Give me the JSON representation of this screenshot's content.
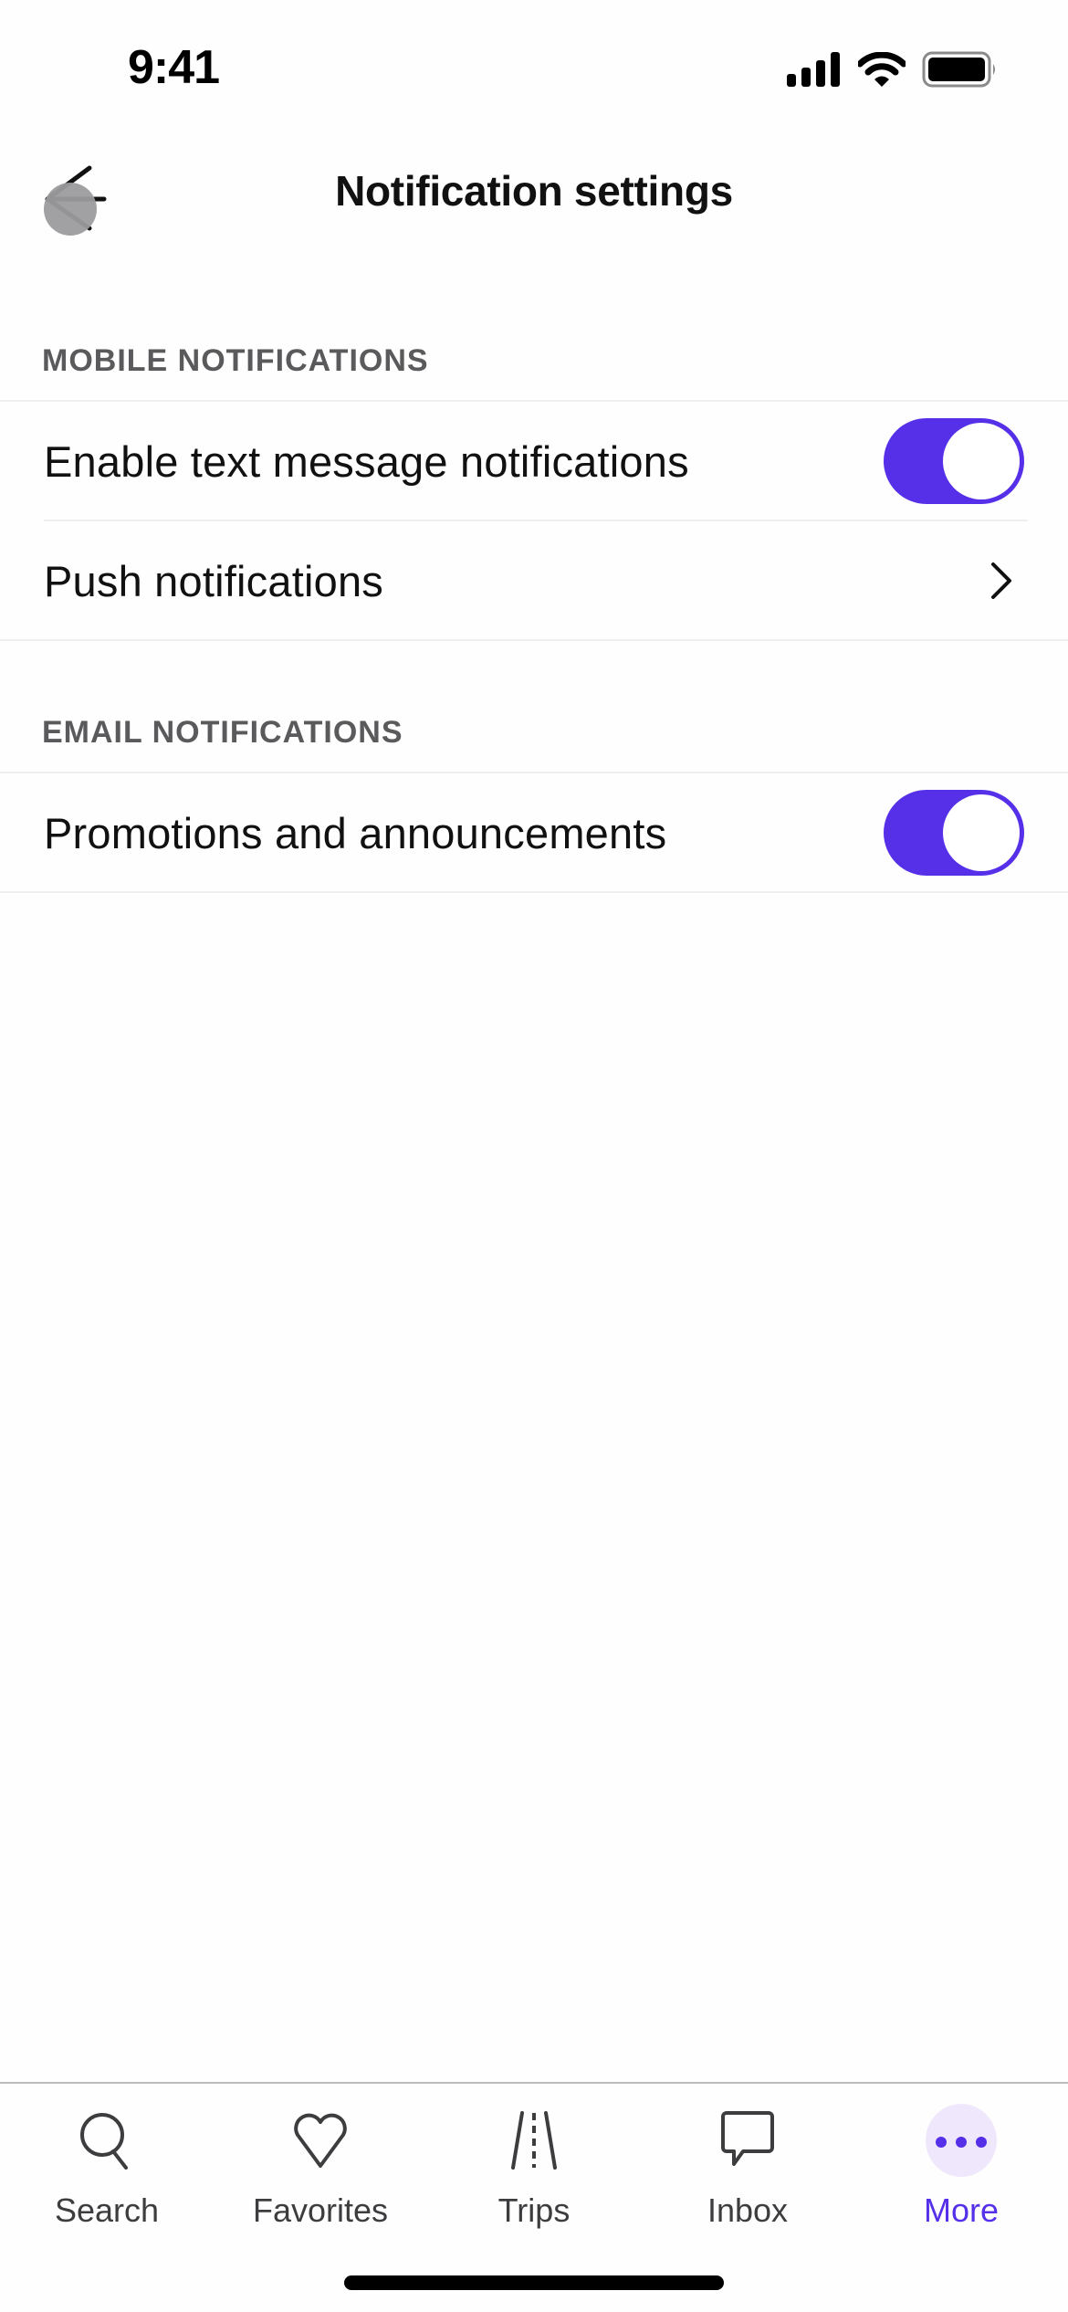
{
  "status_bar": {
    "time": "9:41",
    "icons": [
      "cellular-signal-icon",
      "wifi-icon",
      "battery-icon"
    ]
  },
  "header": {
    "title": "Notification settings",
    "back_icon": "arrow-left-icon"
  },
  "sections": [
    {
      "title": "MOBILE NOTIFICATIONS",
      "rows": [
        {
          "label": "Enable text message notifications",
          "control": "toggle",
          "enabled": true
        },
        {
          "label": "Push notifications",
          "control": "chevron"
        }
      ]
    },
    {
      "title": "EMAIL NOTIFICATIONS",
      "rows": [
        {
          "label": "Promotions and announcements",
          "control": "toggle",
          "enabled": true
        }
      ]
    }
  ],
  "tab_bar": {
    "tabs": [
      {
        "label": "Search",
        "icon": "search-icon",
        "active": false
      },
      {
        "label": "Favorites",
        "icon": "heart-icon",
        "active": false
      },
      {
        "label": "Trips",
        "icon": "road-icon",
        "active": false
      },
      {
        "label": "Inbox",
        "icon": "chat-bubble-icon",
        "active": false
      },
      {
        "label": "More",
        "icon": "more-dots-icon",
        "active": true
      }
    ]
  },
  "colors": {
    "accent": "#5530e8",
    "accent_soft": "#efe8fc",
    "section_header": "#5a595c",
    "text": "#111111"
  }
}
